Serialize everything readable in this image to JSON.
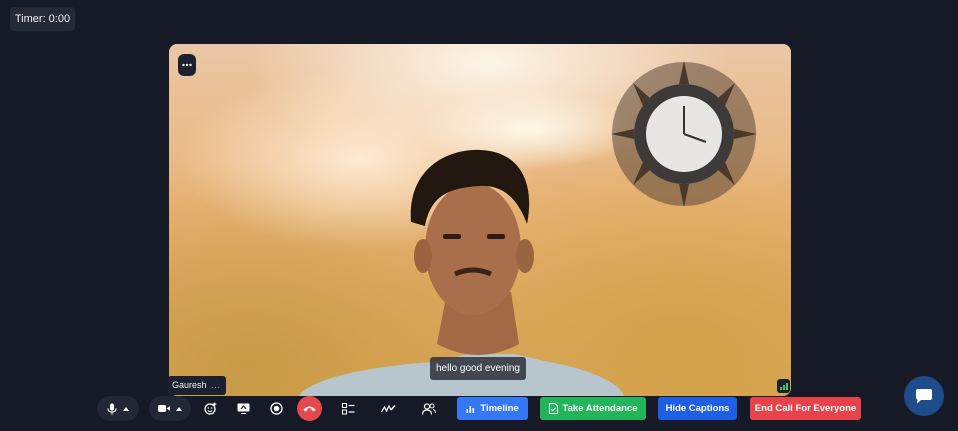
{
  "timer": "Timer: 0:00",
  "participant": {
    "name": "Gauresh",
    "more_glyph": "…"
  },
  "caption": "hello good evening",
  "toolbar": {
    "mic_icon": "mic-icon",
    "camera_icon": "camera-icon",
    "reaction_icon": "emoji-plus-icon",
    "share_icon": "screen-share-icon",
    "record_icon": "record-icon",
    "hangup_icon": "hang-up-icon",
    "poll_icon": "list-icon",
    "whiteboard_icon": "pen-scribble-icon",
    "participants_icon": "people-icon",
    "timeline_label": "Timeline",
    "attendance_label": "Take Attendance",
    "captions_label": "Hide Captions",
    "end_call_label": "End Call For Everyone"
  },
  "colors": {
    "background": "#161a26",
    "primary": "#3478f6",
    "success": "#22b55a",
    "danger": "#e8434a",
    "chat_fab": "#1e4d8c"
  }
}
